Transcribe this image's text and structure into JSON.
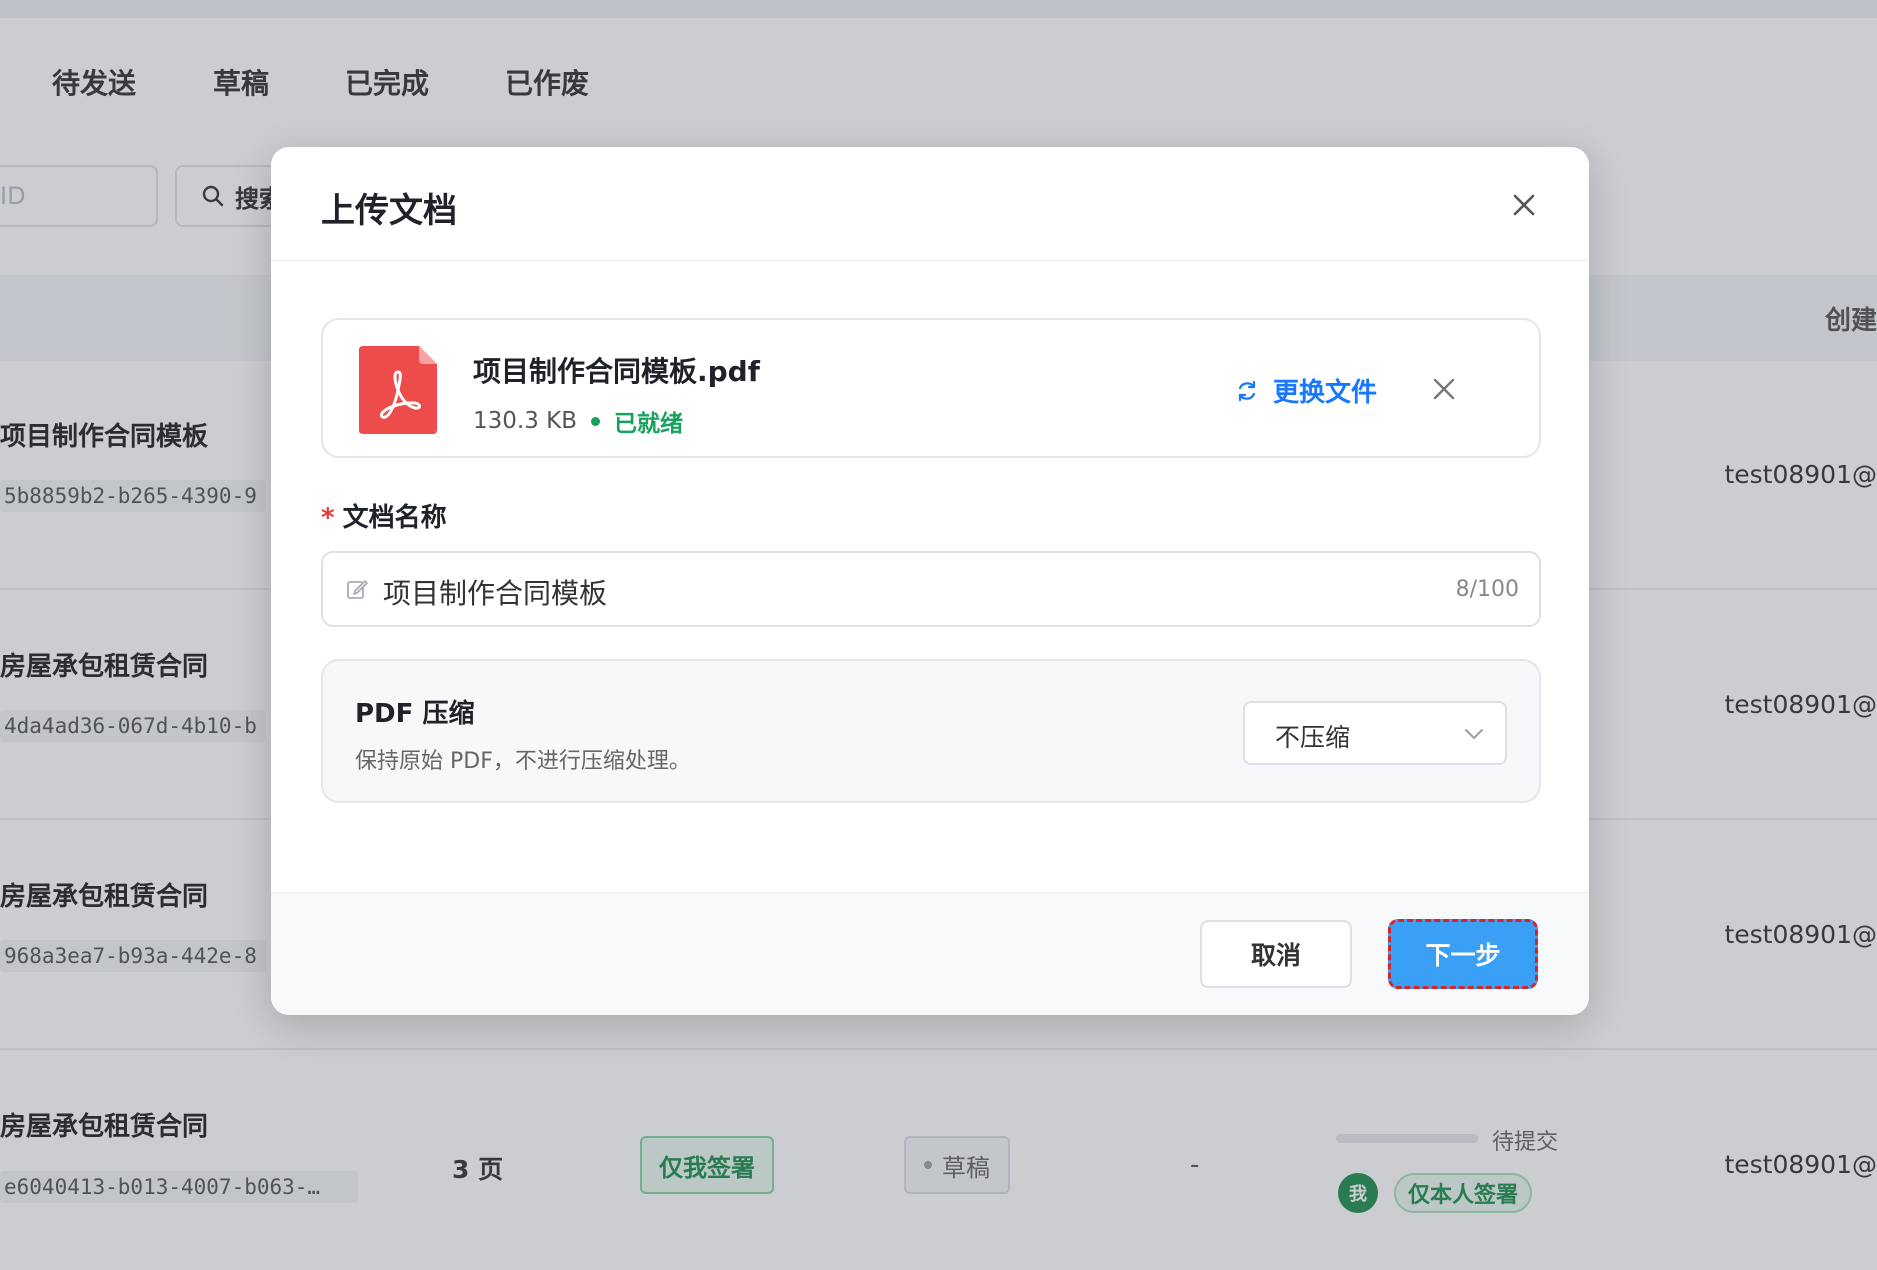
{
  "tabs": [
    "待发送",
    "草稿",
    "已完成",
    "已作废"
  ],
  "filters": {
    "id_placeholder": "ID",
    "search_label": "搜索"
  },
  "table": {
    "created_header": "创建",
    "rows": [
      {
        "title": "项目制作合同模板",
        "id": "5b8859b2-b265-4390-9",
        "email": "test08901@"
      },
      {
        "title": "房屋承包租赁合同",
        "id": "4da4ad36-067d-4b10-b",
        "email": "test08901@"
      },
      {
        "title": "房屋承包租赁合同",
        "id": "968a3ea7-b93a-442e-8",
        "email": "test08901@"
      },
      {
        "title": "房屋承包租赁合同",
        "id": "e6040413-b013-4007-b063-…",
        "pages": "3 页",
        "sign_type": "仅我签署",
        "status": "草稿",
        "deadline": "-",
        "progress_label": "待提交",
        "progress": 0,
        "me": "我",
        "signer_tag": "仅本人签署",
        "email": "test08901@"
      }
    ]
  },
  "modal": {
    "title": "上传文档",
    "file": {
      "name": "项目制作合同模板.pdf",
      "size": "130.3 KB",
      "status": "已就绪",
      "replace_label": "更换文件"
    },
    "doc_name": {
      "label": "文档名称",
      "required_mark": "*",
      "value": "项目制作合同模板",
      "count": "8/100"
    },
    "compress": {
      "title": "PDF 压缩",
      "desc": "保持原始 PDF，不进行压缩处理。",
      "selected": "不压缩"
    },
    "buttons": {
      "cancel": "取消",
      "next": "下一步"
    }
  },
  "colors": {
    "primary": "#1677ff",
    "next_button": "#3aa0f5",
    "ready": "#19a15f",
    "pdf": "#ee4b4b",
    "required": "#e23c39"
  },
  "icons": [
    "close-icon",
    "pdf-file-icon",
    "refresh-icon",
    "edit-icon",
    "chevron-down-icon",
    "search-icon"
  ]
}
